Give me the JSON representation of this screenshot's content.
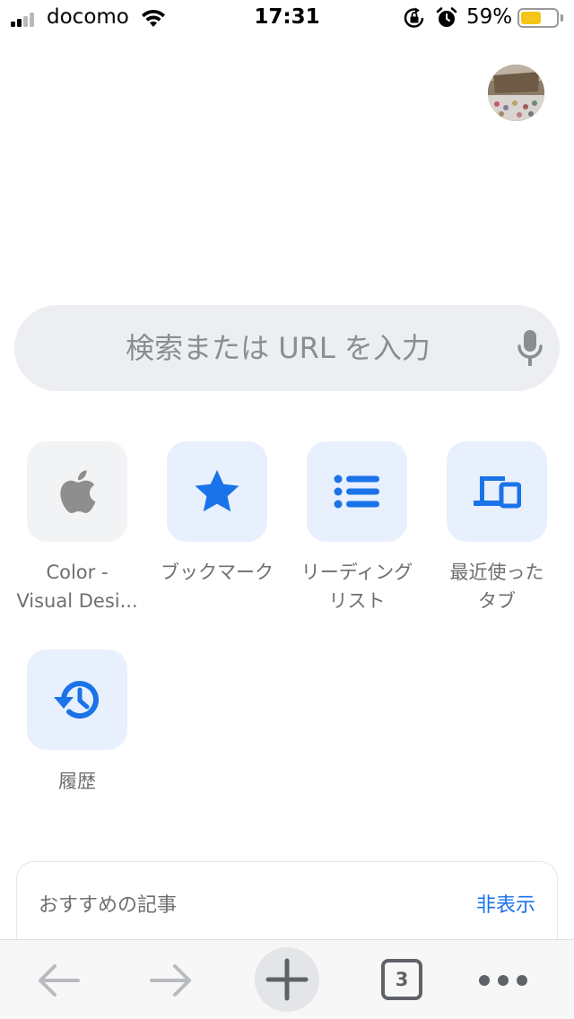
{
  "status_bar": {
    "carrier": "docomo",
    "time": "17:31",
    "battery_percent": "59%",
    "battery_level": 0.59,
    "signal_icon": "cellular-signal-icon",
    "wifi_icon": "wifi-icon",
    "rotation_lock_icon": "rotation-lock-icon",
    "alarm_icon": "alarm-icon"
  },
  "profile": {
    "avatar_icon": "profile-avatar"
  },
  "search": {
    "placeholder": "検索または URL を入力",
    "mic_icon": "microphone-icon"
  },
  "shortcuts": [
    {
      "label_line1": "Color -",
      "label_line2": "Visual Desi...",
      "icon": "apple-logo-icon"
    },
    {
      "label_line1": "ブックマーク",
      "label_line2": "",
      "icon": "star-icon"
    },
    {
      "label_line1": "リーディング",
      "label_line2": "リスト",
      "icon": "list-icon"
    },
    {
      "label_line1": "最近使った",
      "label_line2": "タブ",
      "icon": "devices-icon"
    },
    {
      "label_line1": "履歴",
      "label_line2": "",
      "icon": "history-icon"
    }
  ],
  "articles": {
    "title": "おすすめの記事",
    "hide_label": "非表示"
  },
  "toolbar": {
    "back_icon": "back-arrow-icon",
    "forward_icon": "forward-arrow-icon",
    "new_tab_icon": "plus-icon",
    "tab_count": "3",
    "menu_icon": "more-icon"
  },
  "colors": {
    "accent": "#1a73e8",
    "tile_blue": "#e8f0fe",
    "tile_gray": "#f1f3f4",
    "battery": "#f5c518"
  }
}
